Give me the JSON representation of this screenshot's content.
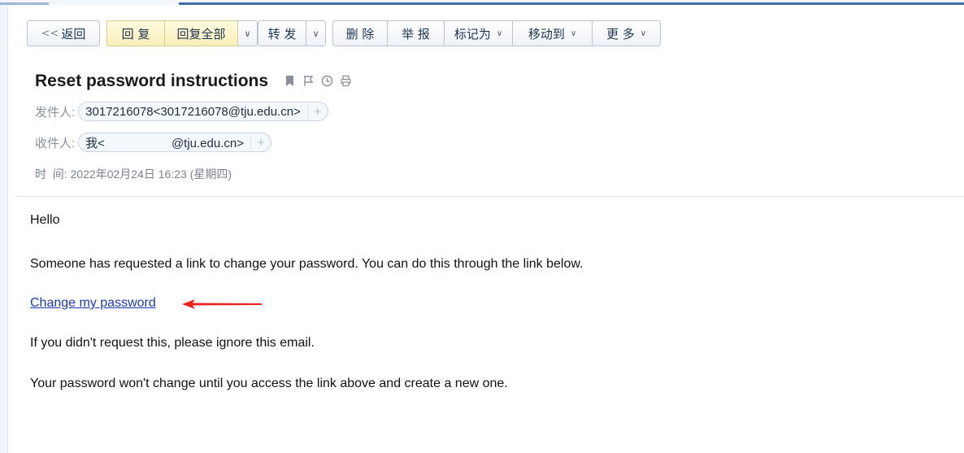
{
  "toolbar": {
    "back": "返回",
    "back_prefix": "<<",
    "reply": "回 复",
    "reply_all": "回复全部",
    "forward": "转 发",
    "delete": "删 除",
    "report": "举 报",
    "mark_as": "标记为",
    "move_to": "移动到",
    "more": "更 多",
    "caret": "∨"
  },
  "email": {
    "subject": "Reset password instructions",
    "from_label": "发件人:",
    "from_address": "3017216078<3017216078@tju.edu.cn>",
    "to_label": "收件人:",
    "to_prefix": "我<",
    "to_suffix": "@tju.edu.cn>",
    "time_label": "时  间:",
    "time_value": "2022年02月24日 16:23 (星期四)",
    "add_symbol": "+"
  },
  "body": {
    "greeting": "Hello",
    "line1": "Someone has requested a link to change your password. You can do this through the link below.",
    "link_text": "Change my password",
    "line2": "If you didn't request this, please ignore this email.",
    "line3": "Your password won't change until you access the link above and create a new one."
  },
  "colors": {
    "link": "#1c3ab0",
    "annotation_arrow": "#e8231e",
    "accent_bar": "#3f6ea6"
  }
}
